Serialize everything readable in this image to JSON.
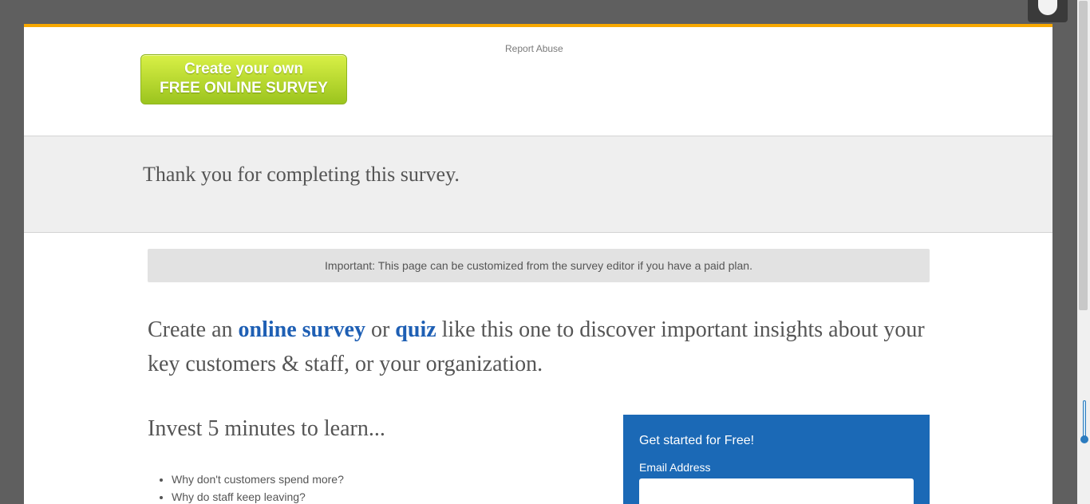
{
  "header": {
    "cta_line1": "Create your own",
    "cta_line2": "FREE ONLINE SURVEY",
    "report_abuse": "Report Abuse"
  },
  "thanks": {
    "message": "Thank you for completing this survey."
  },
  "notice": {
    "text": "Important: This page can be customized from the survey editor if you have a paid plan."
  },
  "headline": {
    "part1": "Create an ",
    "link1": "online survey",
    "part2": " or ",
    "link2": "quiz",
    "part3": " like this one to discover important insights about your key customers & staff, or your organization."
  },
  "invest": {
    "title": "Invest 5 minutes to learn...",
    "items": [
      "Why don't customers spend more?",
      "Why do staff keep leaving?"
    ]
  },
  "signup": {
    "title": "Get started for Free!",
    "email_label": "Email Address",
    "email_value": ""
  },
  "colors": {
    "accent": "#f7a800",
    "link": "#1e5fb4",
    "signup_bg": "#1b69b6",
    "cta_green": "#b5d92f"
  }
}
